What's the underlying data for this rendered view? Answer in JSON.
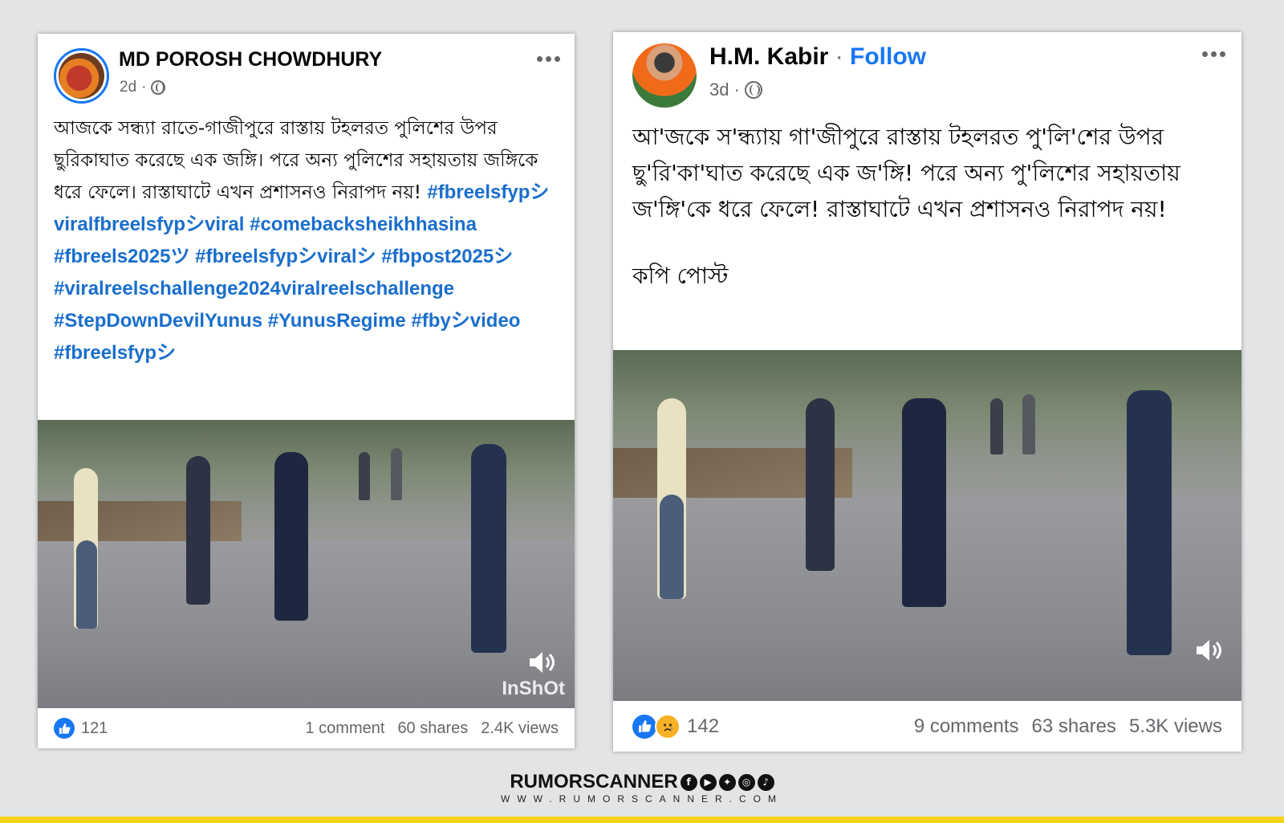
{
  "posts": [
    {
      "author": "MD POROSH CHOWDHURY",
      "time": "2d",
      "time_sep": "·",
      "text": "আজকে সন্ধ্যা রাতে-গাজীপুরে রাস্তায় টহলরত পুলিশের উপর ছুরিকাঘাত করেছে এক জঙ্গি। পরে অন্য পুলিশের সহায়তায় জঙ্গিকে ধরে ফেলে। রাস্তাঘাটে এখন প্রশাসনও নিরাপদ নয়!",
      "hashtags": "#fbreelsfypシviralfbreelsfypシviral #comebacksheikhhasina #fbreels2025ツ #fbreelsfypシviralシ #fbpost2025シ #viralreelschallenge2024viralreelschallenge #StepDownDevilYunus #YunusRegime #fbyシvideo #fbreelsfypシ",
      "video_watermark": "InShOt",
      "reaction_count": "121",
      "comments": "1 comment",
      "shares": "60 shares",
      "views": "2.4K views"
    },
    {
      "author": "H.M. Kabir",
      "author_sep": " · ",
      "follow_label": "Follow",
      "time": "3d",
      "time_sep": "·",
      "text": "আ'জকে স'ন্ধ্যায় গা'জীপুরে রাস্তায় টহলরত পু'লি'শের উপর ছু'রি'কা'ঘাত করেছে এক জ'ঙ্গি! পরে অন্য পু'লিশের সহায়তায় জ'ঙ্গি'কে ধরে ফেলে! রাস্তাঘাটে এখন প্রশাসনও নিরাপদ নয়!",
      "text_footer": "কপি পোস্ট",
      "reaction_count": "142",
      "comments": "9 comments",
      "shares": "63 shares",
      "views": "5.3K views"
    }
  ],
  "branding": {
    "name": "RUMORSCANNER",
    "url": "WWW.RUMORSCANNER.COM",
    "social_icons": [
      "facebook-icon",
      "youtube-icon",
      "twitter-icon",
      "instagram-icon",
      "tiktok-icon"
    ],
    "bar_color": "#f7d21a"
  },
  "colors": {
    "link_blue": "#1877f2",
    "hashtag_blue": "#1a6ecc",
    "meta_gray": "#65676b"
  }
}
